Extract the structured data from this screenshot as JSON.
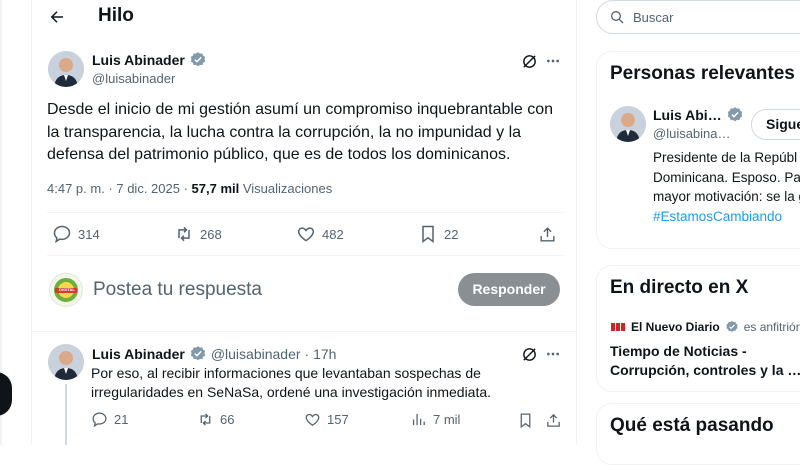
{
  "header": {
    "title": "Hilo"
  },
  "main_post": {
    "author_name": "Luis Abinader",
    "author_handle": "@luisabinader",
    "text": "Desde el inicio de mi gestión asumí un compromiso inquebrantable con la transparencia, la lucha contra la corrupción, la no impunidad y la defensa del patrimonio público, que es de todos los dominicanos.",
    "time": "4:47 p. m. · 7 dic. 2025 ·",
    "views_count": "57,7 mil",
    "views_label": "Visualizaciones",
    "replies": "314",
    "reposts": "268",
    "likes": "482",
    "bookmarks": "22"
  },
  "reply_box": {
    "placeholder": "Postea tu respuesta",
    "button_label": "Responder",
    "avatar_badge": "DIGITAL"
  },
  "reply_post": {
    "author_name": "Luis Abinader",
    "author_handle": "@luisabinader",
    "time": "· 17h",
    "text": "Por eso, al recibir informaciones que levantaban sospechas de irregularidades en SeNaSa, ordené una investigación inmediata.",
    "replies": "21",
    "reposts": "66",
    "likes": "157",
    "views": "7 mil"
  },
  "search": {
    "placeholder": "Buscar"
  },
  "relevant": {
    "title": "Personas relevantes",
    "name": "Luis Abi…",
    "handle": "@luisabina…",
    "follow_label": "Sigue",
    "bio": "Presidente de la Repúbl Dominicana. Esposo. Pa Mi mayor motivación: se la gente.",
    "hashtag": "#EstamosCambiando"
  },
  "live": {
    "title": "En directo en X",
    "host": "El Nuevo Diario",
    "host_suffix": "es anfitrión",
    "event": "Tiempo de Noticias - Corrupción, controles y la …"
  },
  "happening": {
    "title": "Qué está pasando"
  },
  "colors": {
    "accent": "#1d9bf0",
    "verified": "#829aab",
    "text": "#0f1419",
    "muted": "#536471"
  }
}
